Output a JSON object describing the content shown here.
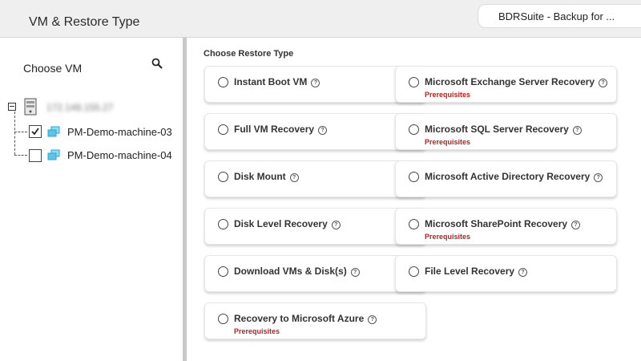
{
  "header": {
    "title": "VM & Restore Type",
    "app_tab": "BDRSuite - Backup for ..."
  },
  "left_panel": {
    "title": "Choose VM",
    "host_label": "172.148.155.27",
    "vms": [
      {
        "label": "PM-Demo-machine-03",
        "checked": true
      },
      {
        "label": "PM-Demo-machine-04",
        "checked": false
      }
    ]
  },
  "main": {
    "section_title": "Choose Restore Type",
    "prerequisites_label": "Prerequisites",
    "options": [
      {
        "label": "Instant Boot VM",
        "prerequisites": false
      },
      {
        "label": "Microsoft Exchange Server Recovery",
        "prerequisites": true
      },
      {
        "label": "Full VM Recovery",
        "prerequisites": false
      },
      {
        "label": "Microsoft SQL Server Recovery",
        "prerequisites": true
      },
      {
        "label": "Disk Mount",
        "prerequisites": false
      },
      {
        "label": "Microsoft Active Directory Recovery",
        "prerequisites": false
      },
      {
        "label": "Disk Level Recovery",
        "prerequisites": false
      },
      {
        "label": "Microsoft SharePoint Recovery",
        "prerequisites": true
      },
      {
        "label": "Download VMs & Disk(s)",
        "prerequisites": false
      },
      {
        "label": "File Level Recovery",
        "prerequisites": false
      },
      {
        "label": "Recovery to Microsoft Azure",
        "prerequisites": true
      }
    ]
  },
  "colors": {
    "prerequisites": "#c21b1b",
    "vm_icon": "#5bc4e8"
  },
  "icons": {
    "search": "search-icon",
    "server": "server-icon",
    "vm": "vm-icon",
    "help": "help-icon",
    "collapse": "collapse-minus-icon",
    "check": "check-icon"
  }
}
